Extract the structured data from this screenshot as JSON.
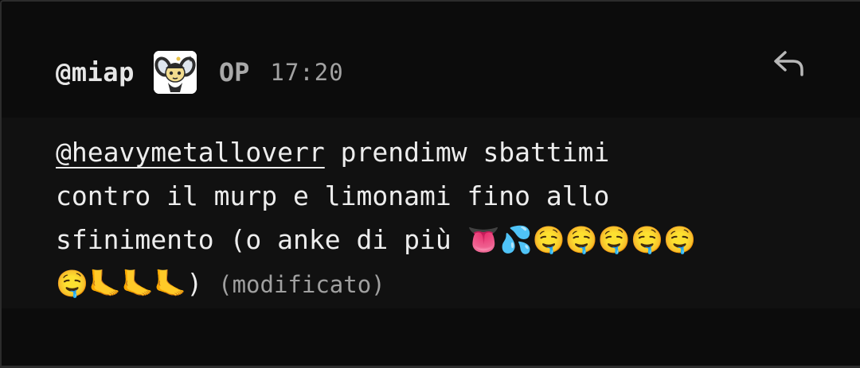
{
  "comment": {
    "author": "@miap",
    "op_label": "OP",
    "time": "17:20",
    "avatar_icon": "cartoon-character-icon",
    "reply_icon": "reply-arrow-icon",
    "text": {
      "mention": "@heavymetalloverr",
      "line1": " prendimw sbattimi",
      "line2": "contro il murp e limonami fino allo",
      "line3": "sfinimento (o anke di più 👅💦🤤🤤🤤🤤🤤",
      "line4": "🤤🦶🦶🦶)",
      "edited_label": "(modificato)"
    }
  },
  "colors": {
    "background": "#0c0c0c",
    "message_band": "#111111",
    "text": "#ededed",
    "muted": "#a2a2a2",
    "border": "#2c2c2c"
  }
}
